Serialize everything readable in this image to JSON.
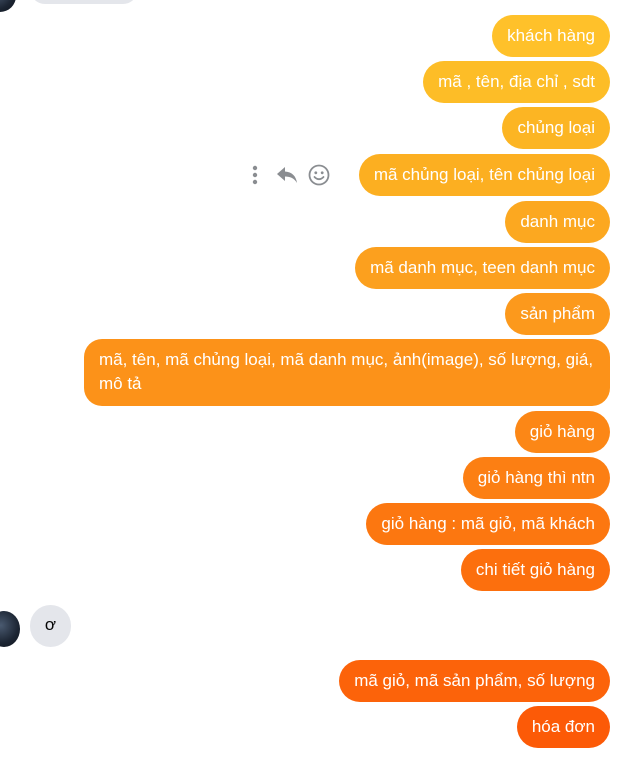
{
  "messages_outgoing": [
    {
      "text": "khách hàng",
      "color": "#FFC12A"
    },
    {
      "text": "mã , tên, địa chỉ , sdt",
      "color": "#FDBD27"
    },
    {
      "text": "chủng loại",
      "color": "#FCB523"
    },
    {
      "text": "mã chủng loại, tên chủng loại",
      "color": "#FCAF21"
    },
    {
      "text": "danh mục",
      "color": "#FCA820"
    },
    {
      "text": "mã danh mục, teen danh mục",
      "color": "#FCA01E"
    },
    {
      "text": "sản phẩm",
      "color": "#FC991C"
    },
    {
      "text": "mã, tên, mã chủng loại, mã danh mục, ảnh(image), số lượng, giá, mô tả",
      "color": "#FC9219"
    },
    {
      "text": "giỏ hàng",
      "color": "#FC8716"
    },
    {
      "text": "giỏ hàng thì ntn",
      "color": "#FC7F13"
    },
    {
      "text": "giỏ hàng : mã giỏ, mã khách",
      "color": "#FC7710"
    },
    {
      "text": "chi tiết giỏ hàng",
      "color": "#FC6F0D"
    },
    {
      "text": "mã giỏ, mã sản phẩm, số lượng",
      "color": "#FC630A"
    },
    {
      "text": "hóa đơn",
      "color": "#FC5A07"
    }
  ],
  "incoming": {
    "text": "ơ"
  },
  "hover_actions": {
    "more": "more-icon",
    "reply": "reply-icon",
    "react": "emoji-icon"
  }
}
